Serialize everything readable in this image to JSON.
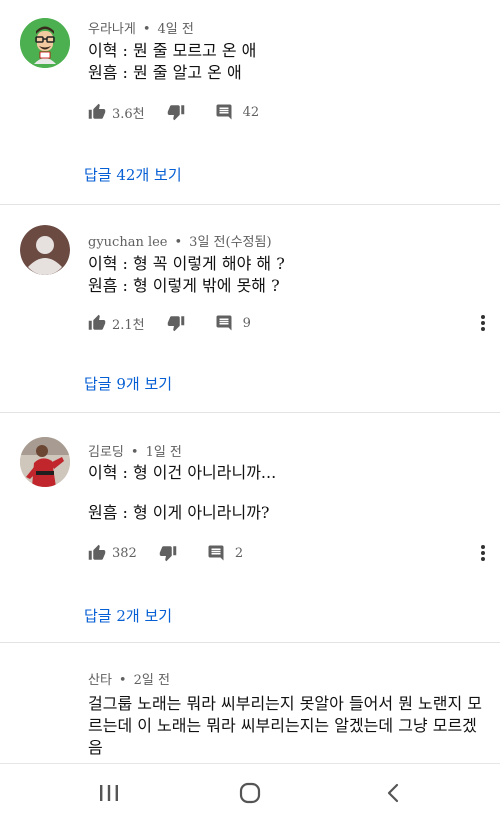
{
  "comments": [
    {
      "author": "우라나게",
      "time": "4일 전",
      "lines": "이혁 : 뭔 줄 모르고 온 애\n원흠 : 뭔 줄 알고 온 애",
      "likes": "3.6천",
      "replies_count": "42",
      "view_replies": "답글 42개 보기",
      "avatar": "cartoon-avatar"
    },
    {
      "author": "gyuchan lee",
      "time": "3일 전(수정됨)",
      "lines": "이혁 : 형 꼭 이렇게 해야 해 ?\n원흠 : 형 이렇게 밖에 못해 ?",
      "likes": "2.1천",
      "replies_count": "9",
      "view_replies": "답글 9개 보기",
      "avatar": "default-avatar"
    },
    {
      "author": "김로딩",
      "time": "1일 전",
      "lines": "이혁 : 형 이건 아니라니까...\n\n원흠 : 형 이게 아니라니까?",
      "likes": "382",
      "replies_count": "2",
      "view_replies": "답글 2개 보기",
      "avatar": "photo-avatar"
    },
    {
      "author": "산타",
      "time": "2일 전",
      "lines": "걸그룹 노래는 뭐라 씨부리는지 못알아 들어서 뭔 노랜지 모르는데 이 노래는 뭐라 씨부리는지는 알겠는데 그냥 모르겠음",
      "avatar": "none"
    }
  ],
  "colors": {
    "accent": "#065fd4",
    "meta": "#606060"
  }
}
